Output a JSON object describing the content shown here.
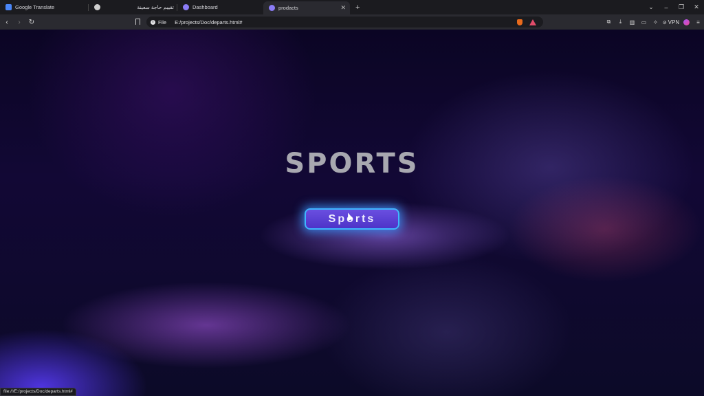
{
  "browser": {
    "tabs": [
      {
        "label": "Google Translate",
        "icon": "translate-icon",
        "color": "#4a86f7"
      },
      {
        "label": "",
        "icon": "chatgpt-icon",
        "color": "#cfcfcf"
      },
      {
        "label": "تقييم حاجة سعينة",
        "icon": "",
        "color": ""
      },
      {
        "label": "Dashboard",
        "icon": "github-icon",
        "color": "#8b7cf6"
      },
      {
        "label": "prodacts",
        "icon": "github-icon",
        "color": "#8b7cf6",
        "active": true
      }
    ],
    "new_tab": "+",
    "address": {
      "scheme": "File",
      "url": "E:/projects/Doc/departs.html#"
    },
    "vpn_label": "VPN",
    "window_controls": [
      "⌄",
      "–",
      "❐",
      "✕"
    ]
  },
  "page": {
    "title": "SPORTS",
    "button_label": "Sports"
  },
  "status_url": "file:///E:/projects/Doc/departs.html#"
}
